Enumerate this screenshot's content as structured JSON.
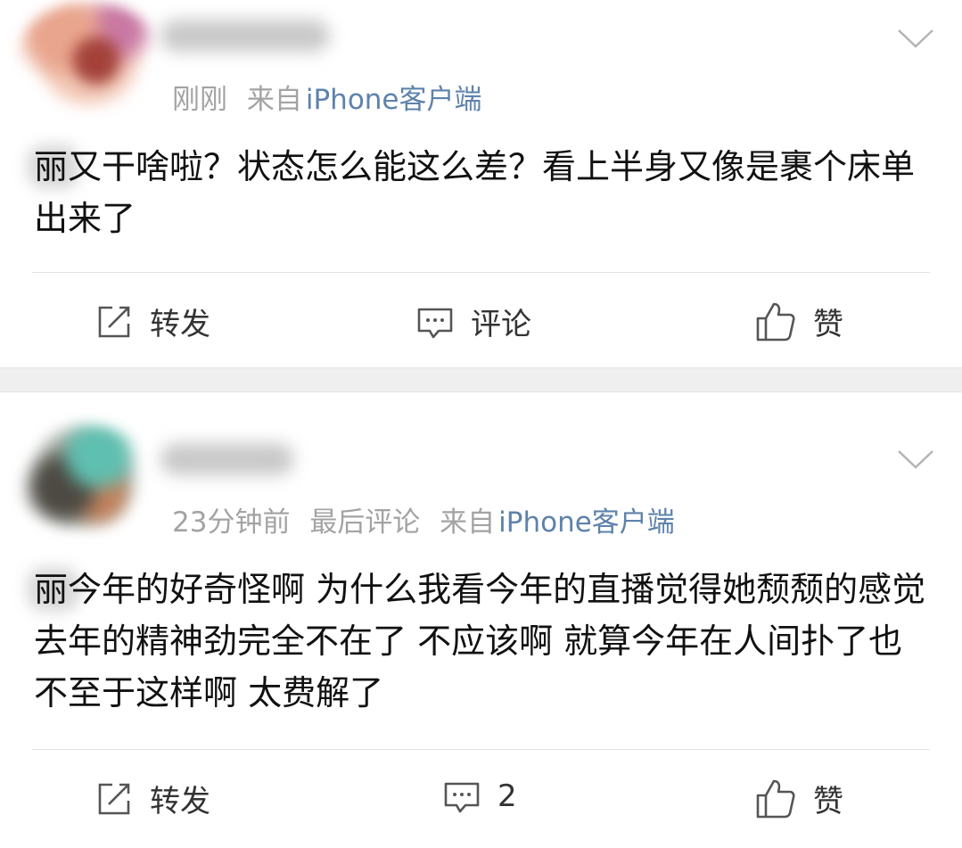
{
  "posts": [
    {
      "time": "刚刚",
      "from_prefix": "来自",
      "source": "iPhone客户端",
      "text": "丽又干啥啦？状态怎么能这么差？看上半身又像是裹个床单出来了",
      "actions": {
        "repost": "转发",
        "comment": "评论",
        "like": "赞"
      }
    },
    {
      "time": "23分钟前",
      "extra": "最后评论",
      "from_prefix": "来自",
      "source": "iPhone客户端",
      "text": "丽今年的好奇怪啊 为什么我看今年的直播觉得她颓颓的感觉 去年的精神劲完全不在了 不应该啊 就算今年在人间扑了也不至于这样啊 太费解了",
      "actions": {
        "repost": "转发",
        "comment": "2",
        "like": "赞"
      }
    }
  ],
  "icons": {
    "repost": "share-icon",
    "comment": "comment-icon",
    "like": "thumbs-up-icon",
    "menu": "chevron-down-icon"
  },
  "colors": {
    "source_link": "#5e82ab",
    "meta_gray": "#a3a3a3",
    "separator": "#efefef"
  }
}
